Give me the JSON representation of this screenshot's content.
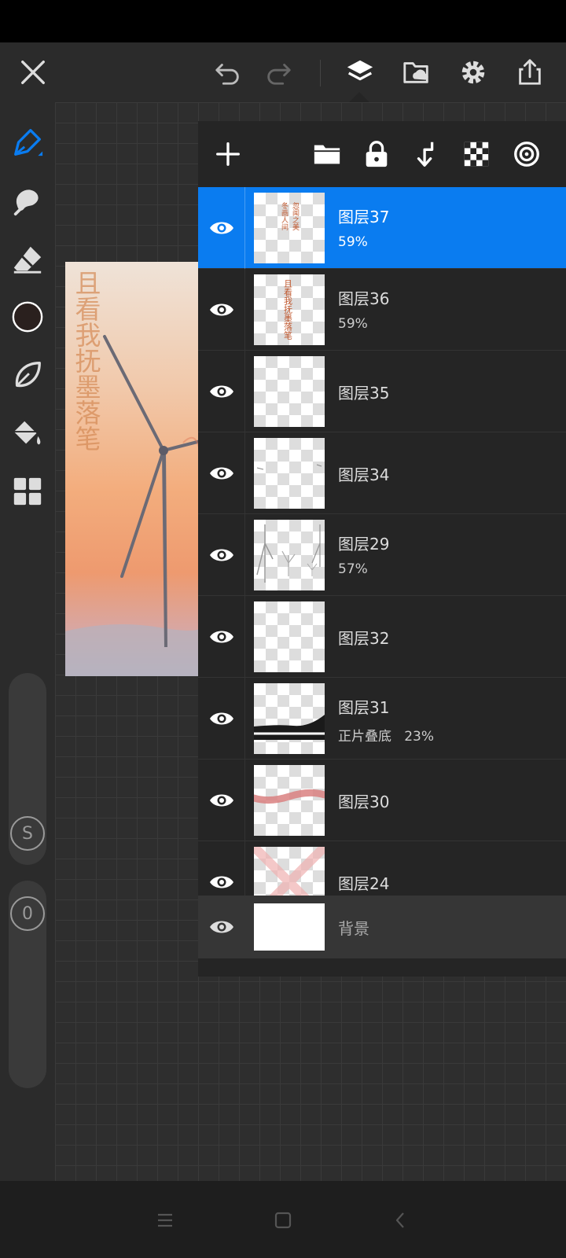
{
  "layers": [
    {
      "name": "图层37",
      "opacity": "59%",
      "blend": "",
      "selected": true,
      "thumb": "text-vertical-double"
    },
    {
      "name": "图层36",
      "opacity": "59%",
      "blend": "",
      "selected": false,
      "thumb": "text-vertical"
    },
    {
      "name": "图层35",
      "opacity": "",
      "blend": "",
      "selected": false,
      "thumb": "empty"
    },
    {
      "name": "图层34",
      "opacity": "",
      "blend": "",
      "selected": false,
      "thumb": "specks"
    },
    {
      "name": "图层29",
      "opacity": "57%",
      "blend": "",
      "selected": false,
      "thumb": "windmills"
    },
    {
      "name": "图层32",
      "opacity": "",
      "blend": "",
      "selected": false,
      "thumb": "empty"
    },
    {
      "name": "图层31",
      "opacity": "23%",
      "blend": "正片叠底",
      "selected": false,
      "thumb": "dark-band"
    },
    {
      "name": "图层30",
      "opacity": "",
      "blend": "",
      "selected": false,
      "thumb": "pink-wave"
    },
    {
      "name": "图层24",
      "opacity": "",
      "blend": "",
      "selected": false,
      "thumb": "pink-x"
    }
  ],
  "background_layer": {
    "name": "背景"
  },
  "artwork": {
    "text": "且看我抚墨落笔"
  },
  "thumb_text": {
    "layer37_col1": "冬画人间",
    "layer37_col2": "忽闻之美",
    "layer36": "且看我抚墨落笔"
  },
  "left_toolbar": {
    "opacity_knob_label": "0",
    "size_knob_label": "S"
  },
  "colors": {
    "accent": "#0a7cf0",
    "current_color": "#2a201e"
  }
}
